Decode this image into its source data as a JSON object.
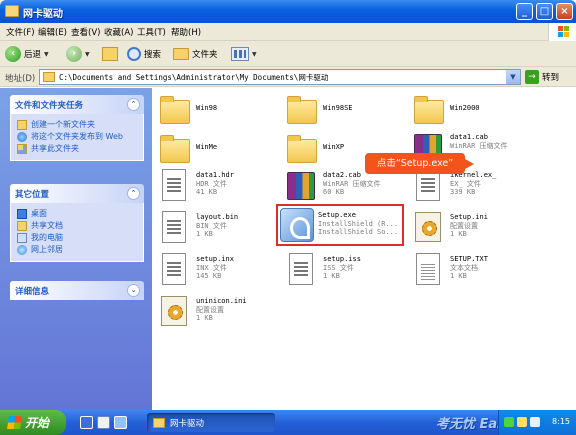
{
  "window": {
    "title": "网卡驱动"
  },
  "menu": [
    "文件(F)",
    "编辑(E)",
    "查看(V)",
    "收藏(A)",
    "工具(T)",
    "帮助(H)"
  ],
  "toolbar": {
    "back": "后退",
    "search": "搜索",
    "folders": "文件夹"
  },
  "address": {
    "label": "地址(D)",
    "path": "C:\\Documents and Settings\\Administrator\\My Documents\\网卡驱动",
    "go": "转到"
  },
  "tasks": {
    "file_tasks": {
      "title": "文件和文件夹任务",
      "items": [
        "创建一个新文件夹",
        "将这个文件夹发布到 Web",
        "共享此文件夹"
      ]
    },
    "other_places": {
      "title": "其它位置",
      "items": [
        "桌面",
        "共享文档",
        "我的电脑",
        "网上邻居"
      ]
    },
    "details": {
      "title": "详细信息"
    }
  },
  "files": [
    {
      "name": "Win98",
      "type": "",
      "size": "",
      "icon": "folder-icon"
    },
    {
      "name": "Win98SE",
      "type": "",
      "size": "",
      "icon": "folder-icon"
    },
    {
      "name": "Win2000",
      "type": "",
      "size": "",
      "icon": "folder-icon"
    },
    {
      "name": "WinMe",
      "type": "",
      "size": "",
      "icon": "folder-icon"
    },
    {
      "name": "WinXP",
      "type": "",
      "size": "",
      "icon": "folder-icon"
    },
    {
      "name": "data1.cab",
      "type": "WinRAR 压缩文件",
      "size": "",
      "icon": "winrar-icon"
    },
    {
      "name": "data1.hdr",
      "type": "HDR 文件",
      "size": "41 KB",
      "icon": "file-icon"
    },
    {
      "name": "data2.cab",
      "type": "WinRAR 压缩文件",
      "size": "60 KB",
      "icon": "winrar-icon"
    },
    {
      "name": "ikernel.ex_",
      "type": "EX_ 文件",
      "size": "339 KB",
      "icon": "file-icon"
    },
    {
      "name": "layout.bin",
      "type": "BIN 文件",
      "size": "1 KB",
      "icon": "file-icon"
    },
    {
      "name": "Setup.exe",
      "type": "InstallShield (R...",
      "size": "InstallShield So...",
      "icon": "installshield-icon"
    },
    {
      "name": "Setup.ini",
      "type": "配置设置",
      "size": "1 KB",
      "icon": "config-icon"
    },
    {
      "name": "setup.inx",
      "type": "INX 文件",
      "size": "145 KB",
      "icon": "file-icon"
    },
    {
      "name": "setup.iss",
      "type": "ISS 文件",
      "size": "1 KB",
      "icon": "file-icon"
    },
    {
      "name": "SETUP.TXT",
      "type": "文本文档",
      "size": "1 KB",
      "icon": "text-icon"
    },
    {
      "name": "uninicon.ini",
      "type": "配置设置",
      "size": "1 KB",
      "icon": "config-icon"
    }
  ],
  "callout": {
    "text": "点击“Setup.exe”"
  },
  "taskbar": {
    "start": "开始",
    "window_button": "网卡驱动",
    "watermark": "考无忧 Easykao",
    "clock": "8:15"
  },
  "colors": {
    "accent": "#0a5fe0",
    "callout": "#f2541b",
    "highlight": "#e02b2b"
  }
}
